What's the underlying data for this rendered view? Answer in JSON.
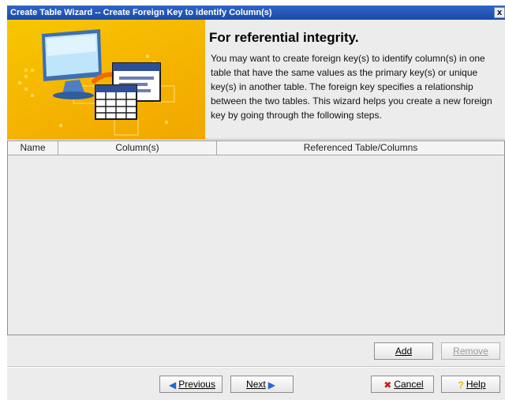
{
  "window": {
    "title": "Create Table Wizard -- Create Foreign Key to identify Column(s)",
    "close_glyph": "x"
  },
  "header": {
    "heading": "For referential integrity.",
    "description": "You may want to create foreign key(s) to identify column(s) in one table that have the same values as the primary key(s) or unique key(s) in another table. The foreign key specifies a relationship between the two tables. This wizard helps you create a new foreign key by going through the following steps.",
    "banner_icon": "computer-tables-illustration"
  },
  "table": {
    "columns": [
      "Name",
      "Column(s)",
      "Referenced Table/Columns"
    ],
    "rows": []
  },
  "actions": {
    "add_label": "Add",
    "remove_label": "Remove"
  },
  "navigation": {
    "previous_label": "Previous",
    "next_label": "Next",
    "cancel_label": "Cancel",
    "help_label": "Help"
  },
  "colors": {
    "title_bar": "#1a4aa8",
    "banner": "#f5b300",
    "panel": "#ececec"
  }
}
